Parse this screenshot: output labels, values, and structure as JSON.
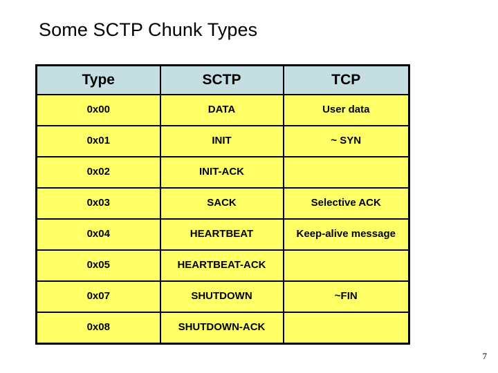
{
  "slide": {
    "title": "Some SCTP Chunk Types",
    "page_number": "7",
    "colors": {
      "header_bg": "#c4dee1",
      "row_bg": "#ffff66",
      "border": "#000000",
      "text": "#000000",
      "background": "#ffffff"
    }
  },
  "table": {
    "headers": [
      "Type",
      "SCTP",
      "TCP"
    ],
    "rows": [
      {
        "type": "0x00",
        "sctp": "DATA",
        "tcp": "User data"
      },
      {
        "type": "0x01",
        "sctp": "INIT",
        "tcp": "~ SYN"
      },
      {
        "type": "0x02",
        "sctp": "INIT-ACK",
        "tcp": ""
      },
      {
        "type": "0x03",
        "sctp": "SACK",
        "tcp": "Selective ACK"
      },
      {
        "type": "0x04",
        "sctp": "HEARTBEAT",
        "tcp": "Keep-alive message"
      },
      {
        "type": "0x05",
        "sctp": "HEARTBEAT-ACK",
        "tcp": ""
      },
      {
        "type": "0x07",
        "sctp": "SHUTDOWN",
        "tcp": "~FIN"
      },
      {
        "type": "0x08",
        "sctp": "SHUTDOWN-ACK",
        "tcp": ""
      }
    ]
  }
}
